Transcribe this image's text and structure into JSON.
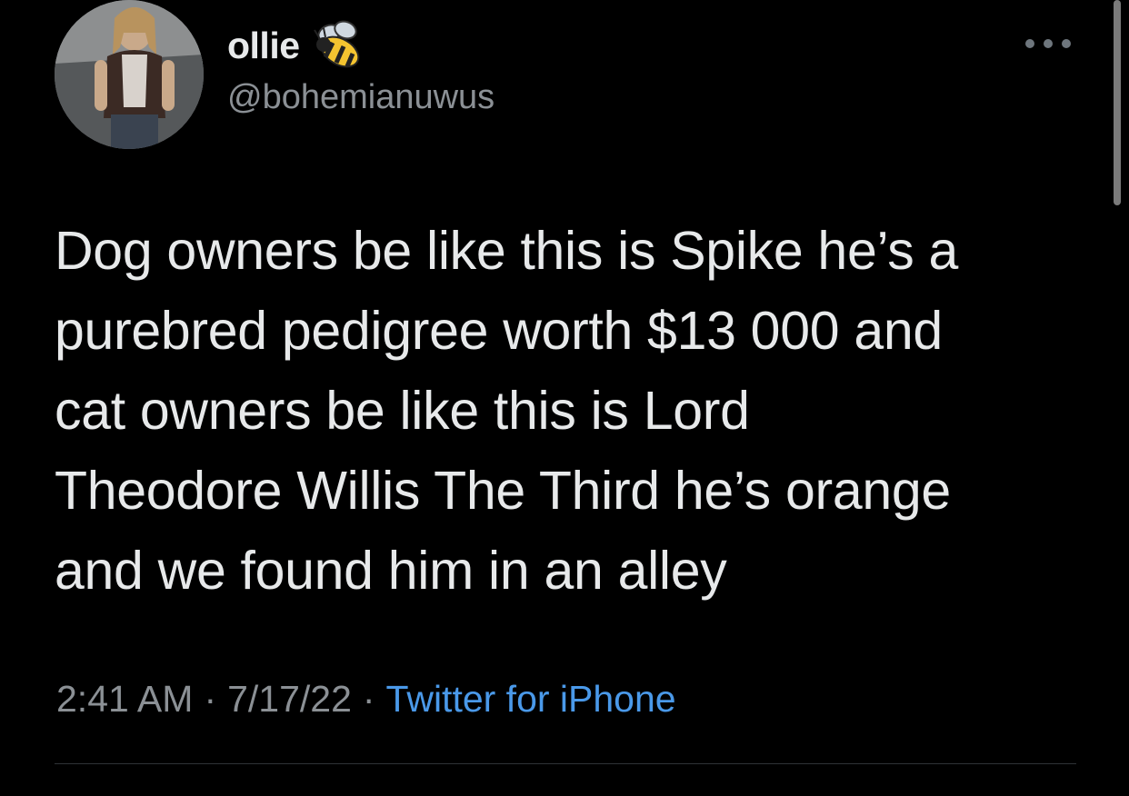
{
  "author": {
    "display_name": "ollie",
    "handle": "@bohemianuwus",
    "name_emoji_icon": "bee-icon",
    "avatar_icon": "profile-photo"
  },
  "tweet": {
    "text": "Dog owners be like this is Spike he’s a\npurebred pedigree worth $13 000 and\ncat owners be like this is Lord\nTheodore Willis The Third he’s orange\nand we found him in an alley",
    "time": "2:41 AM",
    "date": "7/17/22",
    "separator": "·",
    "source": "Twitter for iPhone"
  },
  "menu": {
    "icon": "more-options-icon"
  },
  "colors": {
    "background": "#000000",
    "primary_text": "#e7e9ea",
    "secondary_text": "#8b9095",
    "link": "#4a99e9",
    "divider": "#2f3336"
  }
}
